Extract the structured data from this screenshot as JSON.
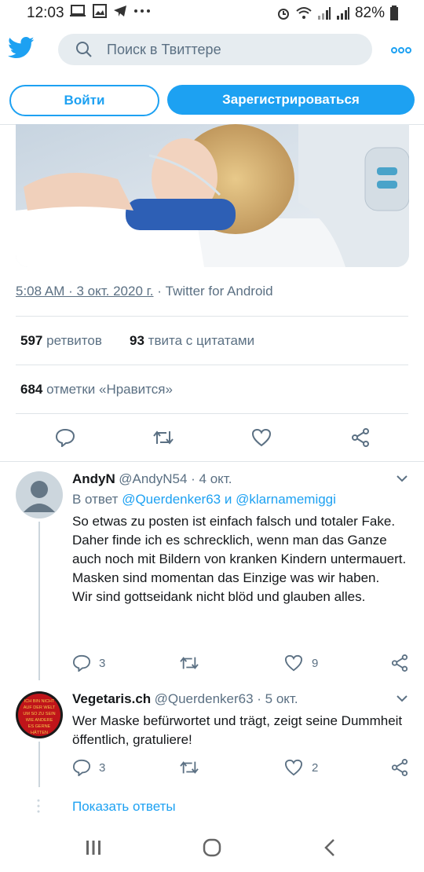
{
  "status_bar": {
    "time": "12:03",
    "battery": "82%",
    "icons": [
      "laptop-icon",
      "image-icon",
      "telegram-icon",
      "more-dots-icon",
      "alarm-icon",
      "wifi-icon",
      "signal-icon",
      "signal-icon",
      "battery-icon"
    ]
  },
  "top_bar": {
    "search_placeholder": "Поиск в Твиттере",
    "login_label": "Войти",
    "signup_label": "Зарегистрироваться"
  },
  "tweet": {
    "time_date": "5:08 AM · 3 окт. 2020 г.",
    "sep": "·",
    "source": "Twitter for Android",
    "retweets_count": "597",
    "retweets_label": "ретвитов",
    "quotes_count": "93",
    "quotes_label": "твита с цитатами",
    "likes_count": "684",
    "likes_label": "отметки «Нравится»"
  },
  "replies": [
    {
      "name": "AndyN",
      "handle": "@AndyN54 · 4 окт.",
      "reply_to_prefix": "В ответ",
      "reply_to_1": "@Querdenker63",
      "reply_to_and": "и",
      "reply_to_2": "@klarnamemiggi",
      "text": "So etwas zu posten ist einfach falsch und totaler Fake.\nDaher finde ich es schrecklich, wenn man das Ganze auch noch mit Bildern von kranken Kindern untermauert.\nMasken sind momentan das Einzige was wir haben.\nWir sind gottseidank nicht blöd und glauben alles.",
      "reply_count": "3",
      "like_count": "9"
    },
    {
      "name": "Vegetaris.ch",
      "handle": "@Querdenker63 · 5 окт.",
      "avatar_text": "ICH BIN NICHT AUF DER WELT UM SO ZU SEIN WIE ANDERE ES GERNE HÄTTEN",
      "text": "Wer Maske befürwortet und trägt, zeigt seine Dummheit öffentlich, gratuliere!",
      "reply_count": "3",
      "like_count": "2"
    }
  ],
  "show_replies_label": "Показать ответы",
  "colors": {
    "accent": "#1da1f2",
    "secondary": "#5b7083",
    "divider": "#dfe4e8"
  }
}
